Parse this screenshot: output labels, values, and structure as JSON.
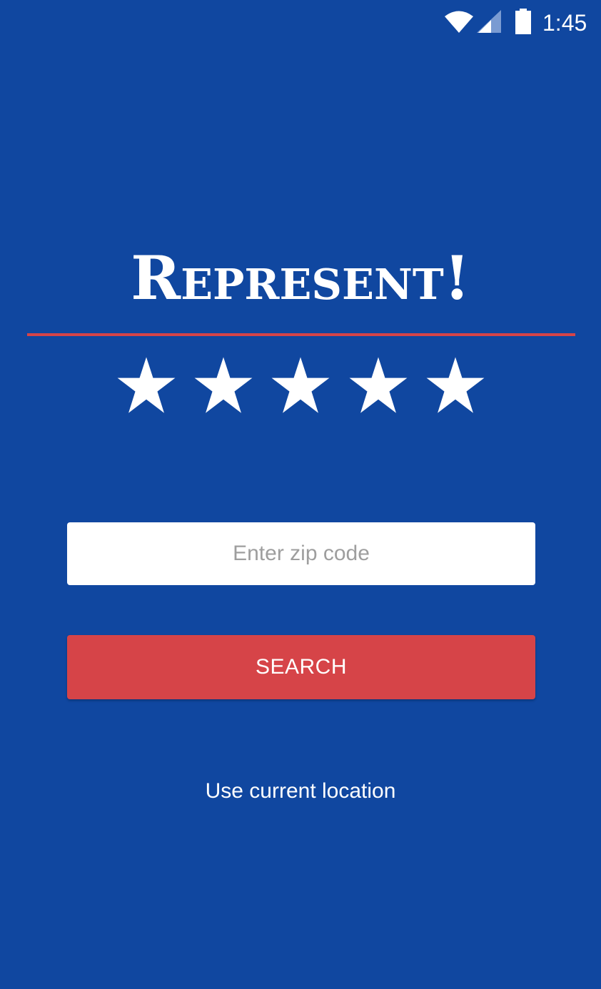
{
  "status_bar": {
    "time": "1:45",
    "icons": [
      "wifi-icon",
      "cell-signal-icon",
      "battery-icon"
    ]
  },
  "app": {
    "title": "Represent!",
    "star_count": 5,
    "colors": {
      "background": "#1047A0",
      "accent": "#D64448",
      "text": "#FFFFFF"
    }
  },
  "search": {
    "placeholder": "Enter zip code",
    "value": "",
    "button_label": "SEARCH"
  },
  "location": {
    "link_label": "Use current location"
  }
}
